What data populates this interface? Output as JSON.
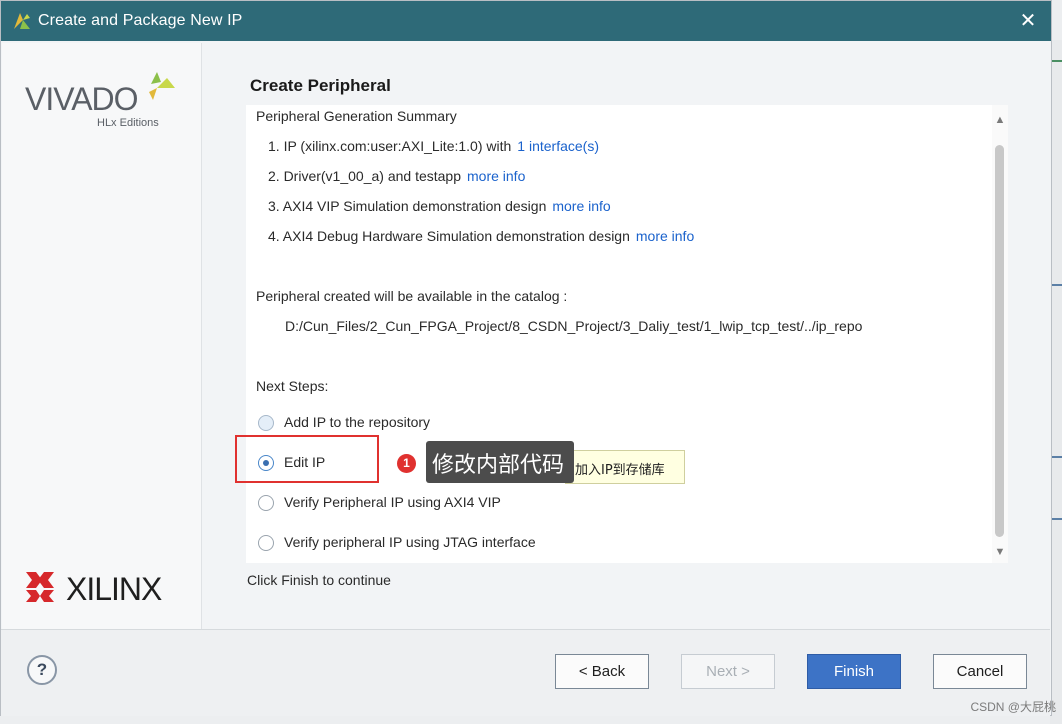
{
  "window": {
    "title": "Create and Package New IP",
    "close_icon": "close-icon"
  },
  "branding": {
    "vivado_word": "VIVADO",
    "vivado_subtitle": "HLx Editions",
    "xilinx_word": "XILINX"
  },
  "page": {
    "title": "Create Peripheral"
  },
  "summary": {
    "heading": "Peripheral Generation Summary",
    "items": [
      {
        "text": "1. IP (xilinx.com:user:AXI_Lite:1.0) with",
        "link": "1 interface(s)"
      },
      {
        "text": "2. Driver(v1_00_a) and testapp",
        "link": "more info"
      },
      {
        "text": "3. AXI4 VIP Simulation demonstration design",
        "link": "more info"
      },
      {
        "text": "4. AXI4 Debug Hardware Simulation demonstration design",
        "link": "more info"
      }
    ],
    "catalog_label": "Peripheral created will be available in the catalog :",
    "catalog_path": "D:/Cun_Files/2_Cun_FPGA_Project/8_CSDN_Project/3_Daliy_test/1_lwip_tcp_test/../ip_repo"
  },
  "next_steps": {
    "heading": "Next Steps:",
    "options": [
      {
        "label": "Add IP to the repository",
        "selected": false
      },
      {
        "label": "Edit IP",
        "selected": true
      },
      {
        "label": "Verify Peripheral IP using AXI4 VIP",
        "selected": false
      },
      {
        "label": "Verify peripheral IP using JTAG interface",
        "selected": false
      }
    ]
  },
  "annotation": {
    "number": "1",
    "label": "修改内部代码",
    "tooltip": "加入IP到存储库",
    "highlight_color": "#e0312f"
  },
  "footer": {
    "hint": "Click Finish to continue"
  },
  "buttons": {
    "help": "?",
    "back": "< Back",
    "next": "Next >",
    "finish": "Finish",
    "cancel": "Cancel"
  },
  "watermark": "CSDN @大屁桃",
  "colors": {
    "titlebar": "#2e6a78",
    "link": "#1a62cc",
    "finish_button": "#3d73c6"
  }
}
